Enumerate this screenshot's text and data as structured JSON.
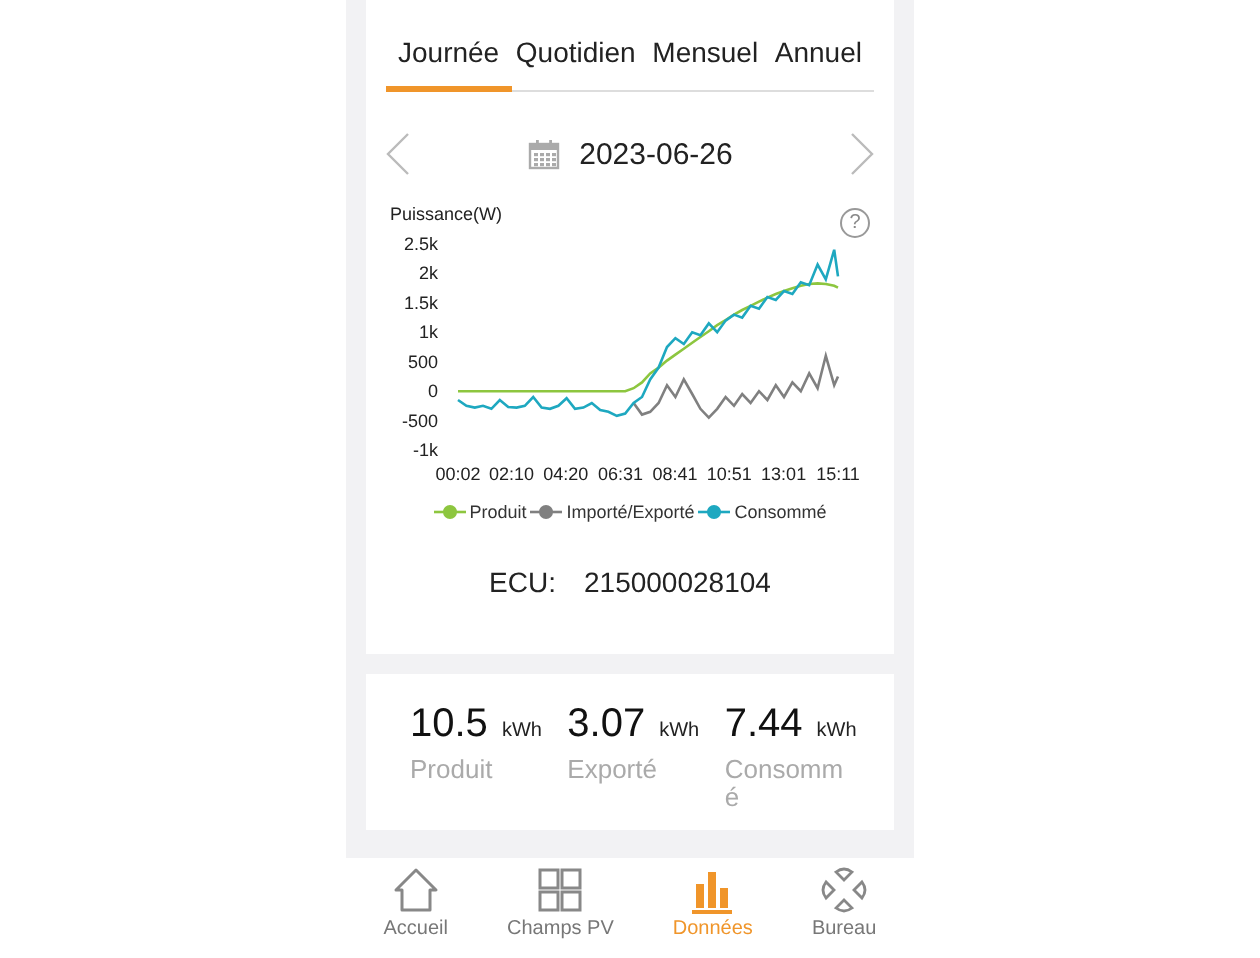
{
  "tabs": [
    {
      "label": "Journée",
      "selected": true
    },
    {
      "label": "Quotidien",
      "selected": false
    },
    {
      "label": "Mensuel",
      "selected": false
    },
    {
      "label": "Annuel",
      "selected": false
    }
  ],
  "date": "2023-06-26",
  "chart_data": {
    "type": "line",
    "ylabel": "Puissance(W)",
    "x": [
      2,
      22,
      42,
      62,
      82,
      102,
      122,
      142,
      162,
      182,
      202,
      222,
      242,
      262,
      282,
      302,
      322,
      342,
      362,
      382,
      402,
      422,
      442,
      462,
      482,
      502,
      522,
      542,
      562,
      582,
      602,
      622,
      642,
      662,
      682,
      702,
      722,
      742,
      762,
      782,
      802,
      822,
      842,
      862,
      882,
      902,
      911
    ],
    "series": [
      {
        "name": "Produit",
        "color": "#8dc63f",
        "values": [
          0,
          0,
          0,
          0,
          0,
          0,
          0,
          0,
          0,
          0,
          0,
          0,
          0,
          0,
          0,
          0,
          0,
          0,
          0,
          0,
          0,
          50,
          150,
          300,
          400,
          520,
          620,
          720,
          820,
          920,
          1020,
          1120,
          1210,
          1300,
          1380,
          1450,
          1520,
          1590,
          1650,
          1700,
          1750,
          1790,
          1820,
          1830,
          1820,
          1790,
          1760
        ]
      },
      {
        "name": "Importé/Exporté",
        "color": "#808080",
        "values": [
          null,
          null,
          null,
          null,
          null,
          null,
          null,
          null,
          null,
          null,
          null,
          null,
          null,
          null,
          null,
          null,
          null,
          null,
          null,
          null,
          null,
          -200,
          -400,
          -350,
          -200,
          100,
          -100,
          200,
          -50,
          -300,
          -450,
          -300,
          -100,
          -250,
          -50,
          -200,
          0,
          -150,
          100,
          -100,
          150,
          0,
          300,
          50,
          600,
          100,
          250
        ]
      },
      {
        "name": "Consommé",
        "color": "#1ea8c0",
        "values": [
          -150,
          -250,
          -280,
          -250,
          -300,
          -150,
          -270,
          -280,
          -250,
          -100,
          -280,
          -300,
          -250,
          -120,
          -300,
          -280,
          -200,
          -320,
          -350,
          -420,
          -380,
          -200,
          -100,
          200,
          400,
          750,
          900,
          800,
          1000,
          950,
          1150,
          1000,
          1200,
          1300,
          1250,
          1450,
          1400,
          1600,
          1550,
          1700,
          1650,
          1850,
          1800,
          2150,
          1900,
          2400,
          1950
        ]
      }
    ],
    "xlim": [
      2,
      911
    ],
    "ylim": [
      -1000,
      2500
    ],
    "xticks": [
      {
        "value": 2,
        "label": "00:02"
      },
      {
        "value": 130,
        "label": "02:10"
      },
      {
        "value": 260,
        "label": "04:20"
      },
      {
        "value": 391,
        "label": "06:31"
      },
      {
        "value": 521,
        "label": "08:41"
      },
      {
        "value": 651,
        "label": "10:51"
      },
      {
        "value": 781,
        "label": "13:01"
      },
      {
        "value": 911,
        "label": "15:11"
      }
    ],
    "yticks": [
      {
        "value": 2500,
        "label": "2.5k"
      },
      {
        "value": 2000,
        "label": "2k"
      },
      {
        "value": 1500,
        "label": "1.5k"
      },
      {
        "value": 1000,
        "label": "1k"
      },
      {
        "value": 500,
        "label": "500"
      },
      {
        "value": 0,
        "label": "0"
      },
      {
        "value": -500,
        "label": "-500"
      },
      {
        "value": -1000,
        "label": "-1k"
      }
    ]
  },
  "help_icon": "?",
  "ecu": {
    "label": "ECU:",
    "value": "215000028104"
  },
  "stats": [
    {
      "value": "10.5",
      "unit": "kWh",
      "label": "Produit"
    },
    {
      "value": "3.07",
      "unit": "kWh",
      "label": "Exporté"
    },
    {
      "value": "7.44",
      "unit": "kWh",
      "label": "Consommé"
    }
  ],
  "nav": [
    {
      "kind": "home",
      "label": "Accueil",
      "selected": false
    },
    {
      "kind": "grid",
      "label": "Champs PV",
      "selected": false
    },
    {
      "kind": "bars",
      "label": "Données",
      "selected": true
    },
    {
      "kind": "bureau",
      "label": "Bureau",
      "selected": false
    }
  ]
}
